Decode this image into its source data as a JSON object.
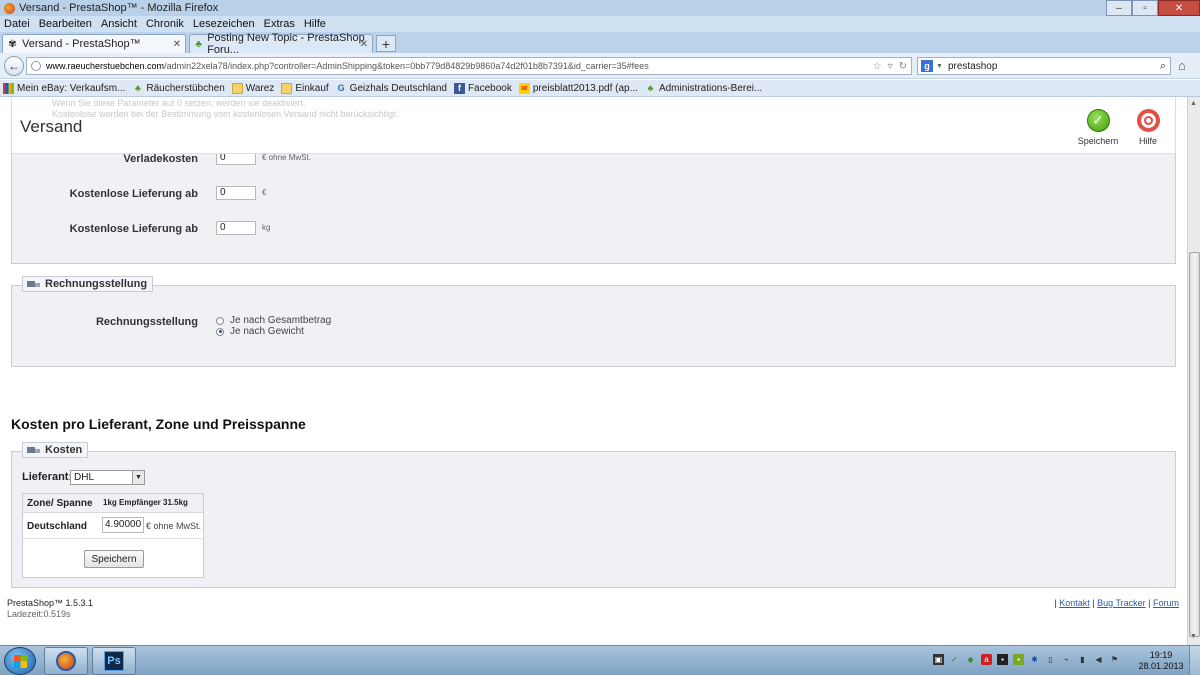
{
  "window": {
    "title": "Versand - PrestaShop™ - Mozilla Firefox",
    "menu": [
      "Datei",
      "Bearbeiten",
      "Ansicht",
      "Chronik",
      "Lesezeichen",
      "Extras",
      "Hilfe"
    ]
  },
  "tabs": [
    {
      "label": "Versand - PrestaShop™",
      "active": true
    },
    {
      "label": "Posting New Topic - PrestaShop Foru...",
      "active": false
    }
  ],
  "nav": {
    "url_host": "www.raeucherstuebchen.com",
    "url_path": "/admin22xela78/index.php?controller=AdminShipping&token=0bb779d84829b9860a74d2f01b8b7391&id_carrier=35#fees",
    "search_engine_icon": "google-icon",
    "search_value": "prestashop"
  },
  "bookmarks": [
    {
      "label": "Mein eBay: Verkaufsm...",
      "icon": "ebay-icon"
    },
    {
      "label": "Räucherstübchen",
      "icon": "leaf-icon"
    },
    {
      "label": "Warez",
      "icon": "folder-icon"
    },
    {
      "label": "Einkauf",
      "icon": "folder-icon"
    },
    {
      "label": "Geizhals Deutschland",
      "icon": "geizhals-icon"
    },
    {
      "label": "Facebook",
      "icon": "facebook-icon"
    },
    {
      "label": "preisblatt2013.pdf (ap...",
      "icon": "post-icon"
    },
    {
      "label": "Administrations-Berei...",
      "icon": "leaf-icon"
    }
  ],
  "page": {
    "title": "Versand",
    "toolbar": {
      "save": "Speichern",
      "help": "Hilfe"
    },
    "fees": {
      "verladekosten_label": "Verladekosten",
      "verladekosten_value": "0",
      "verladekosten_unit": "€ ohne MwSt.",
      "free_price_label": "Kostenlose Lieferung ab",
      "free_price_value": "0",
      "free_price_unit": "€",
      "free_weight_label": "Kostenlose Lieferung ab",
      "free_weight_value": "0",
      "free_weight_unit": "kg"
    },
    "billing": {
      "legend": "Rechnungsstellung",
      "label": "Rechnungsstellung",
      "options": [
        {
          "label": "Je nach Gesamtbetrag",
          "checked": false
        },
        {
          "label": "Je nach Gewicht",
          "checked": true
        }
      ]
    },
    "costs_heading": "Kosten pro Lieferant, Zone und Preisspanne",
    "costs": {
      "legend": "Kosten",
      "carrier_label": "Lieferant:",
      "carrier_value": "DHL",
      "table_header_zone": "Zone/ Spanne",
      "table_header_range": "1kg Empfänger 31.5kg",
      "row_zone": "Deutschland",
      "row_value": "4.90000",
      "row_unit": "€ ohne MwSt.",
      "save_button": "Speichern"
    },
    "footer": {
      "version": "PrestaShop™ 1.5.3.1",
      "load_time": "Ladezeit:0.519s",
      "links": [
        "Kontakt",
        "Bug Tracker",
        "Forum"
      ]
    }
  },
  "taskbar": {
    "time": "19:19",
    "date": "28.01.2013"
  }
}
